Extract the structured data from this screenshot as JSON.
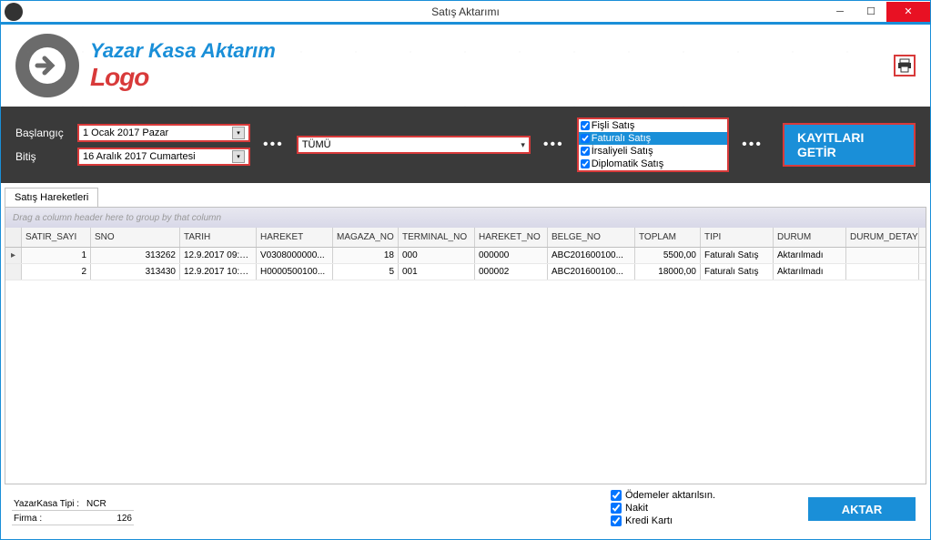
{
  "window": {
    "title": "Satış Aktarımı"
  },
  "header": {
    "title": "Yazar Kasa Aktarım",
    "logo": "Logo"
  },
  "filters": {
    "start_label": "Başlangıç",
    "end_label": "Bitiş",
    "start_value": "1    Ocak    2017    Pazar",
    "end_value": "16   Aralık   2017 Cumartesi",
    "store_combo": "TÜMÜ",
    "types": [
      {
        "label": "Fişli Satış",
        "checked": true,
        "selected": false
      },
      {
        "label": "Faturalı Satış",
        "checked": true,
        "selected": true
      },
      {
        "label": "İrsaliyeli Satış",
        "checked": true,
        "selected": false
      },
      {
        "label": "Diplomatik Satış",
        "checked": true,
        "selected": false
      }
    ],
    "fetch_btn": "KAYITLARI GETİR"
  },
  "tabs": {
    "sales": "Satış Hareketleri"
  },
  "grid": {
    "group_hint": "Drag a column header here to group by that column",
    "columns": [
      "SATIR_SAYI",
      "SNO",
      "TARIH",
      "HAREKET",
      "MAGAZA_NO",
      "TERMINAL_NO",
      "HAREKET_NO",
      "BELGE_NO",
      "TOPLAM",
      "TIPI",
      "DURUM",
      "DURUM_DETAY"
    ],
    "rows": [
      {
        "SATIR_SAYI": "1",
        "SNO": "313262",
        "TARIH": "12.9.2017 09:3...",
        "HAREKET": "V0308000000...",
        "MAGAZA_NO": "18",
        "TERMINAL_NO": "000",
        "HAREKET_NO": "000000",
        "BELGE_NO": "ABC201600100...",
        "TOPLAM": "5500,00",
        "TIPI": "Faturalı Satış",
        "DURUM": "Aktarılmadı",
        "DURUM_DETAY": ""
      },
      {
        "SATIR_SAYI": "2",
        "SNO": "313430",
        "TARIH": "12.9.2017 10:1...",
        "HAREKET": "H0000500100...",
        "MAGAZA_NO": "5",
        "TERMINAL_NO": "001",
        "HAREKET_NO": "000002",
        "BELGE_NO": "ABC201600100...",
        "TOPLAM": "18000,00",
        "TIPI": "Faturalı Satış",
        "DURUM": "Aktarılmadı",
        "DURUM_DETAY": ""
      }
    ]
  },
  "footer": {
    "yk_label": "YazarKasa Tipi :",
    "yk_value": "NCR",
    "firma_label": "Firma :",
    "firma_value": "126",
    "opt_payments": "Ödemeler aktarılsın.",
    "opt_cash": "Nakit",
    "opt_card": "Kredi Kartı",
    "aktar_btn": "AKTAR"
  }
}
